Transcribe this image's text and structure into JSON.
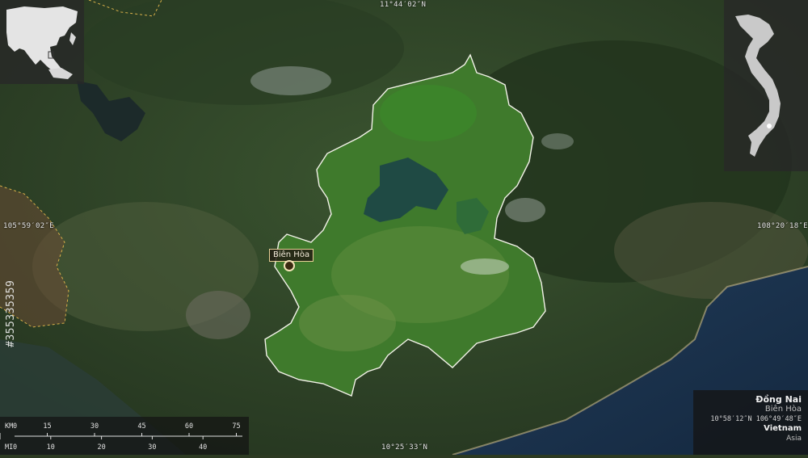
{
  "map": {
    "coords": {
      "top": "11°44′02″N",
      "bottom": "10°25′33″N",
      "left": "105°59′02″E",
      "right": "108°20′18″E"
    },
    "city_label": "Biên Hòa",
    "colors": {
      "land_dark": "#2f4a2a",
      "region_fill": "#3f7a2c",
      "region_outline": "#f2f2e8",
      "sea": "#1c3350",
      "reservoir": "#1f4a44",
      "border_dashed": "#d9b14a"
    }
  },
  "info_panel": {
    "region": "Đồng Nai",
    "city": "Biên Hòa",
    "coords": "10°58′12″N 106°49′48″E",
    "country": "Vietnam",
    "continent": "Asia"
  },
  "scale": {
    "km_label": "KM",
    "mi_label": "MI",
    "km_ticks": [
      "0",
      "15",
      "30",
      "45",
      "60",
      "75"
    ],
    "mi_ticks": [
      "0",
      "10",
      "20",
      "30",
      "40"
    ]
  },
  "watermark": "#355335359"
}
